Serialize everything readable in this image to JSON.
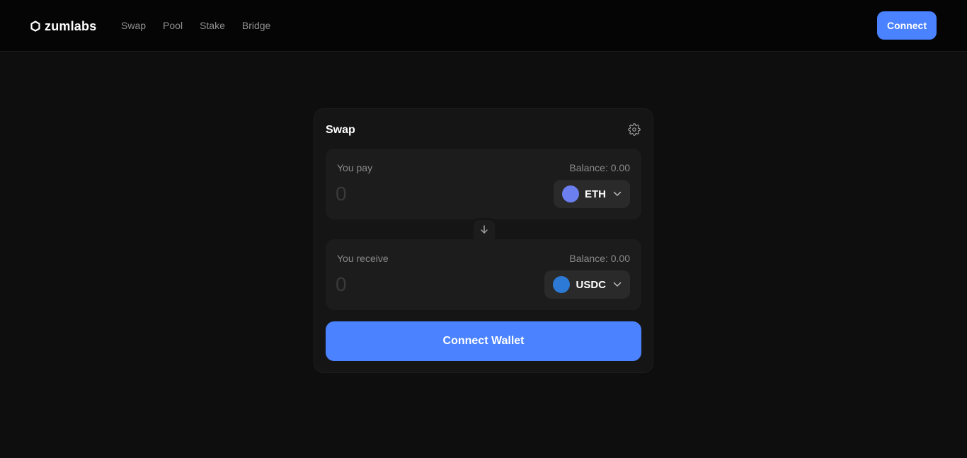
{
  "header": {
    "brand": "zumlabs",
    "nav": [
      "Swap",
      "Pool",
      "Stake",
      "Bridge"
    ],
    "connect_label": "Connect"
  },
  "swap": {
    "title": "Swap",
    "pay": {
      "label": "You pay",
      "balance": "Balance: 0.00",
      "placeholder": "0",
      "token": "ETH",
      "token_color": "#6b7ff0"
    },
    "receive": {
      "label": "You receive",
      "balance": "Balance: 0.00",
      "placeholder": "0",
      "token": "USDC",
      "token_color": "#2d7ad6"
    },
    "button_label": "Connect Wallet"
  },
  "colors": {
    "accent": "#4a82ff",
    "background": "#0e0e0e",
    "card": "#151515"
  },
  "icons": [
    "logo-hex-icon",
    "gear-icon",
    "chevron-down-icon",
    "arrow-down-icon"
  ]
}
